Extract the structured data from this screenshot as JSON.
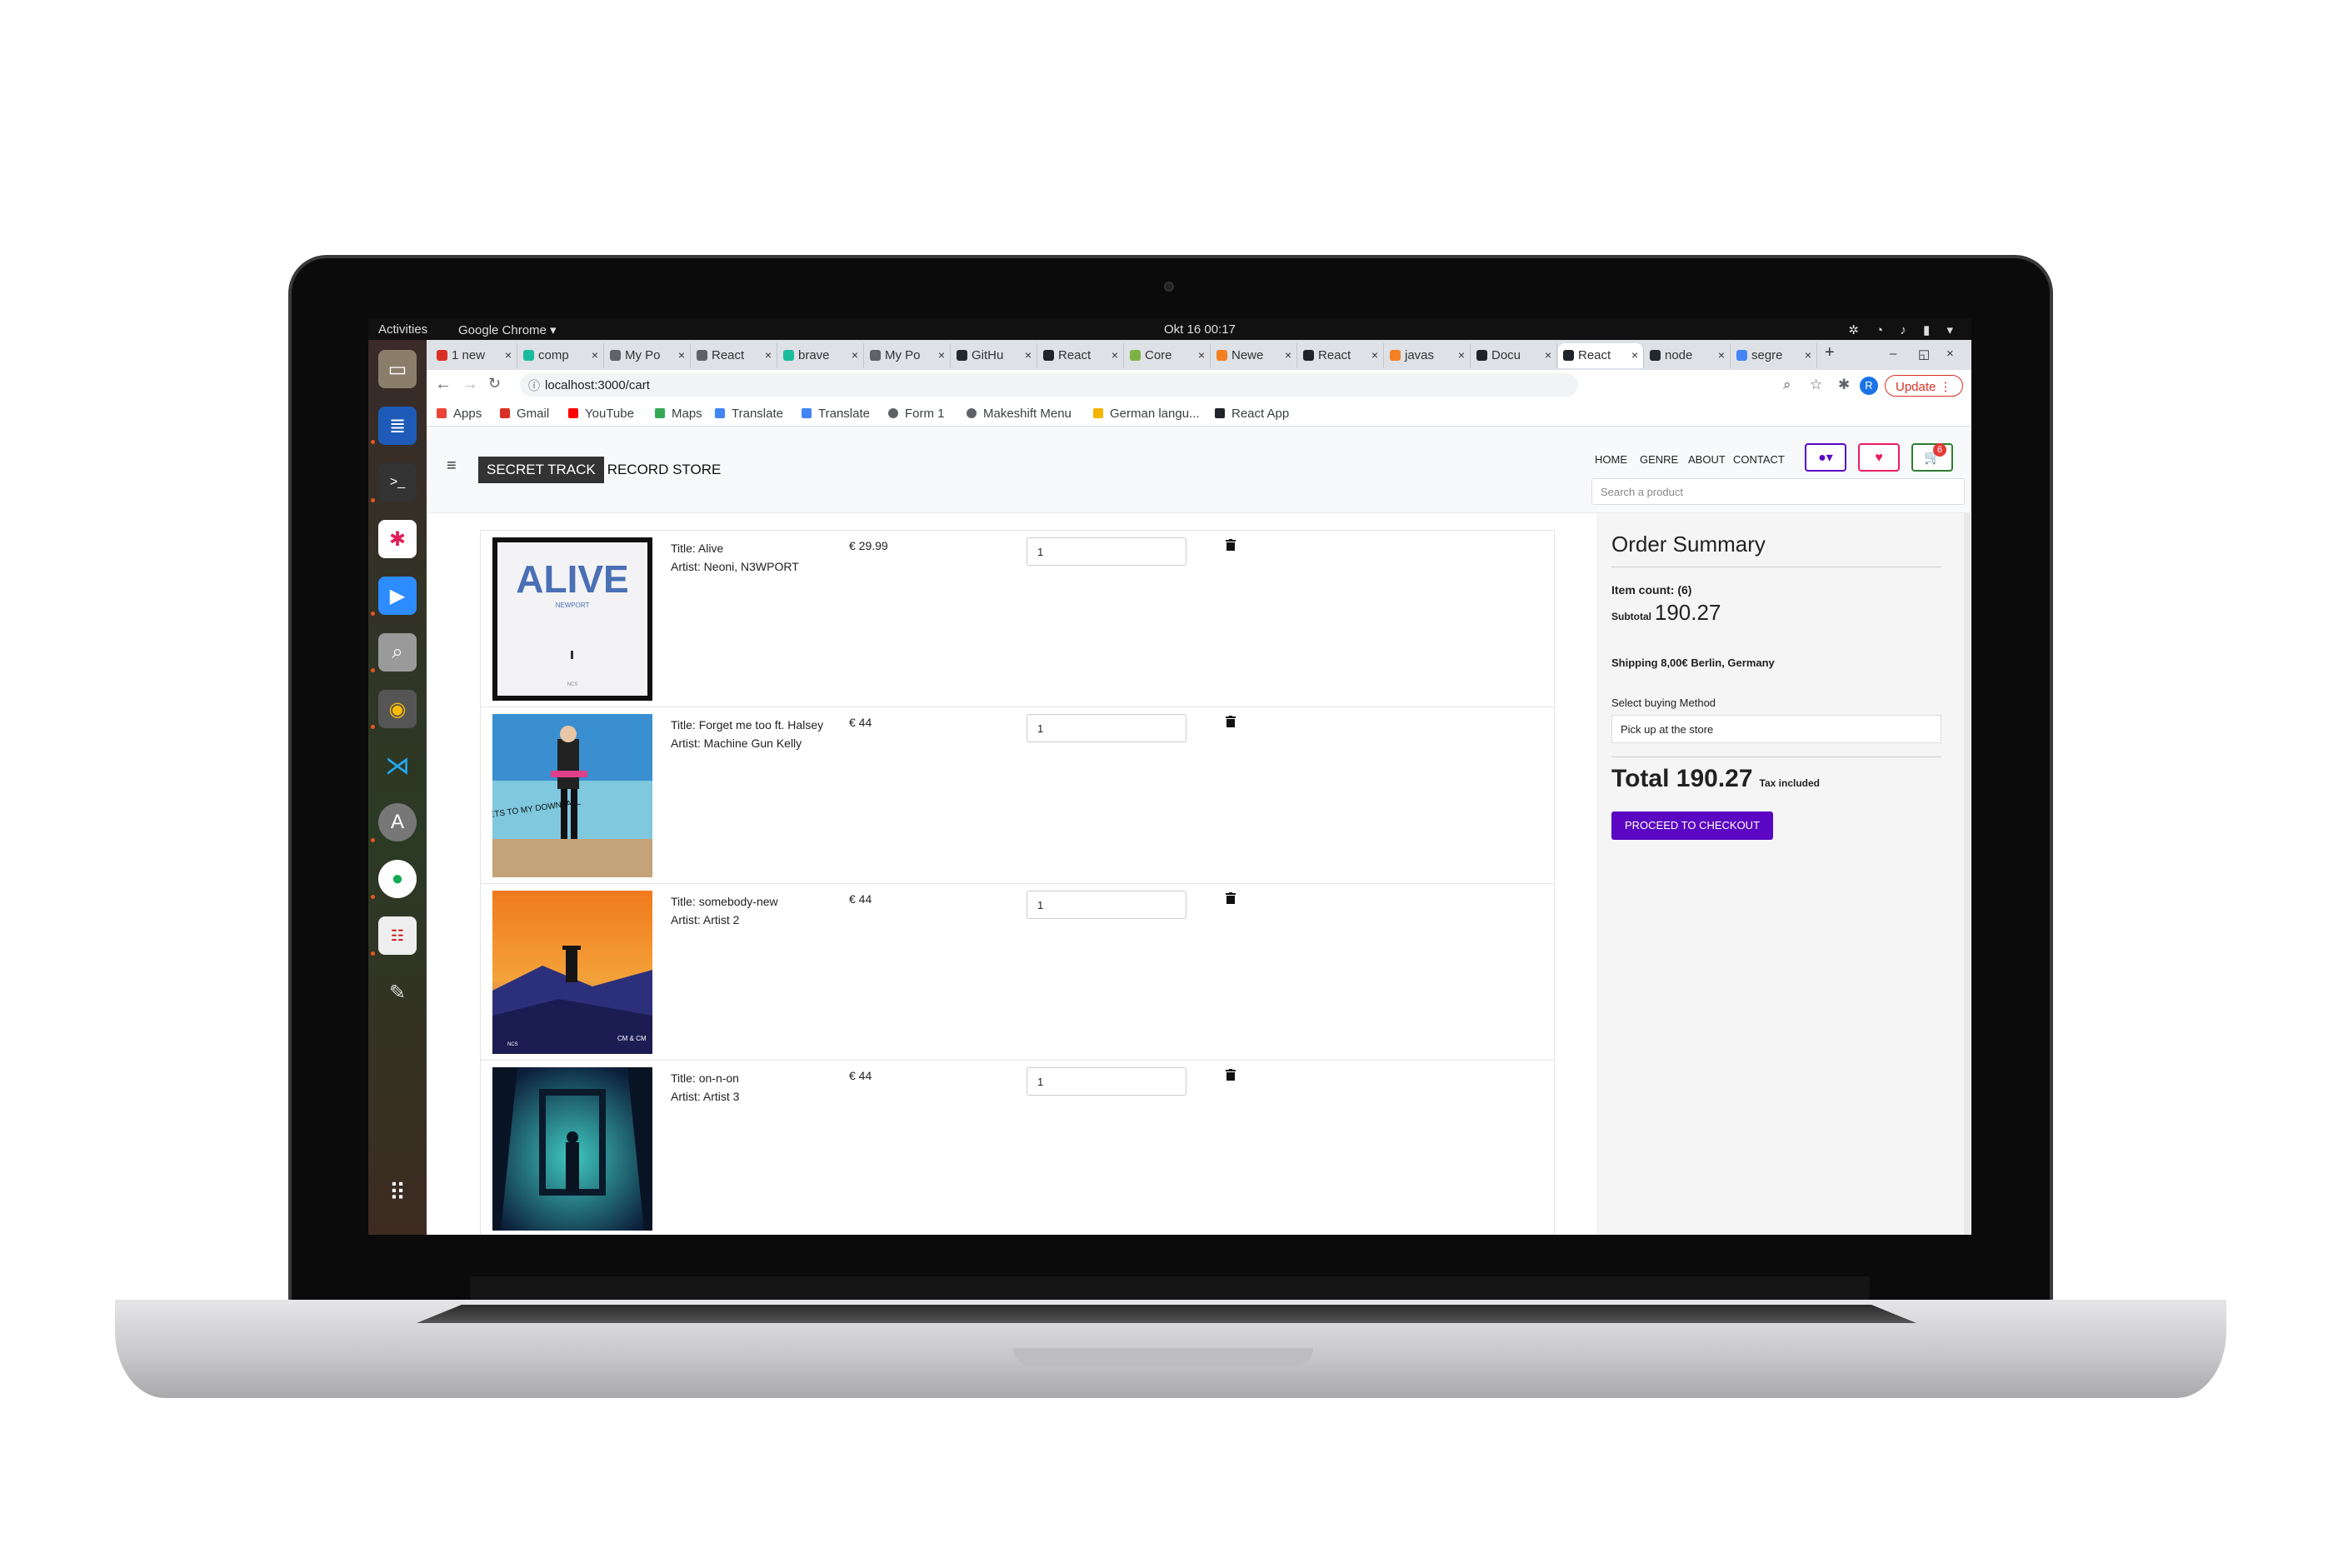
{
  "system": {
    "activities": "Activities",
    "app_name": "Google Chrome ▾",
    "clock": "Okt 16  00:17"
  },
  "browser": {
    "tabs": [
      {
        "label": "1 new"
      },
      {
        "label": "comp"
      },
      {
        "label": "My Po"
      },
      {
        "label": "React"
      },
      {
        "label": "brave"
      },
      {
        "label": "My Po"
      },
      {
        "label": "GitHu"
      },
      {
        "label": "React"
      },
      {
        "label": "Core"
      },
      {
        "label": "Newe"
      },
      {
        "label": "React"
      },
      {
        "label": "javas"
      },
      {
        "label": "Docu"
      },
      {
        "label": "React"
      },
      {
        "label": "node"
      },
      {
        "label": "segre"
      }
    ],
    "new_tab": "+",
    "url": "localhost:3000/cart",
    "profile_initial": "R",
    "update_label": "Update",
    "bookmarks": [
      {
        "label": "Apps",
        "color": "#ea4335"
      },
      {
        "label": "Gmail",
        "color": "#d93025"
      },
      {
        "label": "YouTube",
        "color": "#ff0000"
      },
      {
        "label": "Maps",
        "color": "#34a853"
      },
      {
        "label": "Translate",
        "color": "#4285f4"
      },
      {
        "label": "Translate",
        "color": "#4285f4"
      },
      {
        "label": "Form 1",
        "color": "#5f6368"
      },
      {
        "label": "Makeshift Menu",
        "color": "#5f6368"
      },
      {
        "label": "German langu...",
        "color": "#f4b400"
      },
      {
        "label": "React App",
        "color": "#20232a"
      }
    ]
  },
  "store": {
    "brand_box": "SECRET TRACK",
    "brand_rest": "RECORD STORE",
    "nav": [
      "HOME",
      "GENRE",
      "ABOUT",
      "CONTACT"
    ],
    "cart_count": "6",
    "search_placeholder": "Search a product",
    "accent_color": "#5b06c2"
  },
  "cart": {
    "items": [
      {
        "title": "Title: Alive",
        "artist": "Artist: Neoni, N3WPORT",
        "price": "€ 29.99",
        "qty": "1"
      },
      {
        "title": "Title: Forget me too ft. Halsey",
        "artist": "Artist: Machine Gun Kelly",
        "price": "€ 44",
        "qty": "1"
      },
      {
        "title": "Title: somebody-new",
        "artist": "Artist: Artist 2",
        "price": "€ 44",
        "qty": "1"
      },
      {
        "title": "Title: on-n-on",
        "artist": "Artist: Artist 3",
        "price": "€ 44",
        "qty": "1"
      }
    ],
    "cover_art": [
      "ALIVE",
      "NEWPORT",
      "NCS",
      "TICKETS TO MY DOWNFALL",
      "NCS",
      "CM & CM"
    ]
  },
  "summary": {
    "title": "Order Summary",
    "item_count": "Item count: (6)",
    "subtotal_label": "Subtotal",
    "subtotal_value": "190.27",
    "shipping": "Shipping 8,00€ Berlin, Germany",
    "method_label": "Select buying Method",
    "method_value": "Pick up at the store",
    "total_label": "Total 190.27",
    "tax_note": "Tax included",
    "checkout": "PROCEED TO CHECKOUT"
  }
}
